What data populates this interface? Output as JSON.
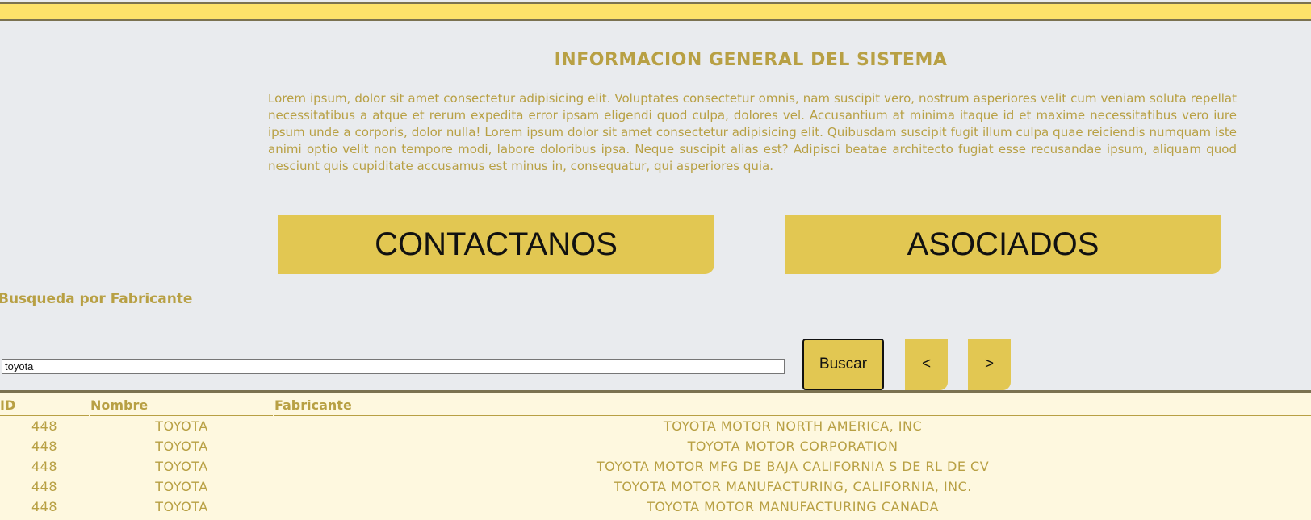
{
  "header": {
    "title": "INFORMACION GENERAL DEL SISTEMA",
    "intro": "Lorem ipsum, dolor sit amet consectetur adipisicing elit. Voluptates consectetur omnis, nam suscipit vero, nostrum asperiores velit cum veniam soluta repellat necessitatibus a atque et rerum expedita error ipsam eligendi quod culpa, dolores vel. Accusantium at minima itaque id et maxime necessitatibus vero iure ipsum unde a corporis, dolor nulla! Lorem ipsum dolor sit amet consectetur adipisicing elit. Quibusdam suscipit fugit illum culpa quae reiciendis numquam iste animi optio velit non tempore modi, labore doloribus ipsa. Neque suscipit alias est? Adipisci beatae architecto fugiat esse recusandae ipsum, aliquam quod nesciunt quis cupiditate accusamus est minus in, consequatur, qui asperiores quia."
  },
  "actions": {
    "contact_label": "CONTACTANOS",
    "partners_label": "ASOCIADOS"
  },
  "search": {
    "label": "Busqueda por Fabricante",
    "value": "toyota",
    "button_label": "Buscar",
    "prev_label": "<",
    "next_label": ">"
  },
  "table": {
    "headers": [
      "ID",
      "Nombre",
      "Fabricante"
    ],
    "rows": [
      [
        "448",
        "TOYOTA",
        "TOYOTA MOTOR NORTH AMERICA, INC"
      ],
      [
        "448",
        "TOYOTA",
        "TOYOTA MOTOR CORPORATION"
      ],
      [
        "448",
        "TOYOTA",
        "TOYOTA MOTOR MFG DE BAJA CALIFORNIA S DE RL DE CV"
      ],
      [
        "448",
        "TOYOTA",
        "TOYOTA MOTOR MANUFACTURING, CALIFORNIA, INC."
      ],
      [
        "448",
        "TOYOTA",
        "TOYOTA MOTOR MANUFACTURING CANADA"
      ]
    ]
  },
  "colors": {
    "page_background": "#e9ebee",
    "top_bar": "#fde26a",
    "accent_button": "#e2c752",
    "text_gold": "#b8a044",
    "results_background": "#fef8df"
  }
}
